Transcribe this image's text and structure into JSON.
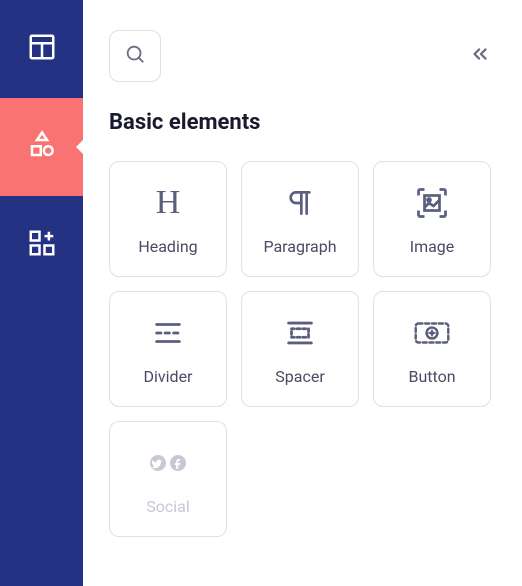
{
  "sidebar": {
    "items": [
      {
        "name": "layout",
        "active": false
      },
      {
        "name": "elements",
        "active": true
      },
      {
        "name": "widgets",
        "active": false
      }
    ]
  },
  "section": {
    "title": "Basic elements"
  },
  "tiles": [
    {
      "key": "heading",
      "label": "Heading",
      "disabled": false
    },
    {
      "key": "paragraph",
      "label": "Paragraph",
      "disabled": false
    },
    {
      "key": "image",
      "label": "Image",
      "disabled": false
    },
    {
      "key": "divider",
      "label": "Divider",
      "disabled": false
    },
    {
      "key": "spacer",
      "label": "Spacer",
      "disabled": false
    },
    {
      "key": "button",
      "label": "Button",
      "disabled": false
    },
    {
      "key": "social",
      "label": "Social",
      "disabled": true
    }
  ]
}
